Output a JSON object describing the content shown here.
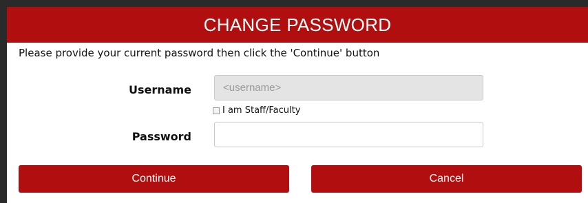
{
  "dialog": {
    "title": "CHANGE PASSWORD",
    "instructions": "Please provide your current password then click the 'Continue' button"
  },
  "form": {
    "username_label": "Username",
    "username_placeholder": "<username>",
    "staff_checkbox_label": "I am Staff/Faculty",
    "staff_checked": false,
    "password_label": "Password",
    "password_value": ""
  },
  "buttons": {
    "continue_label": "Continue",
    "cancel_label": "Cancel"
  },
  "colors": {
    "accent": "#b10f0f",
    "background": "#ffffff"
  }
}
